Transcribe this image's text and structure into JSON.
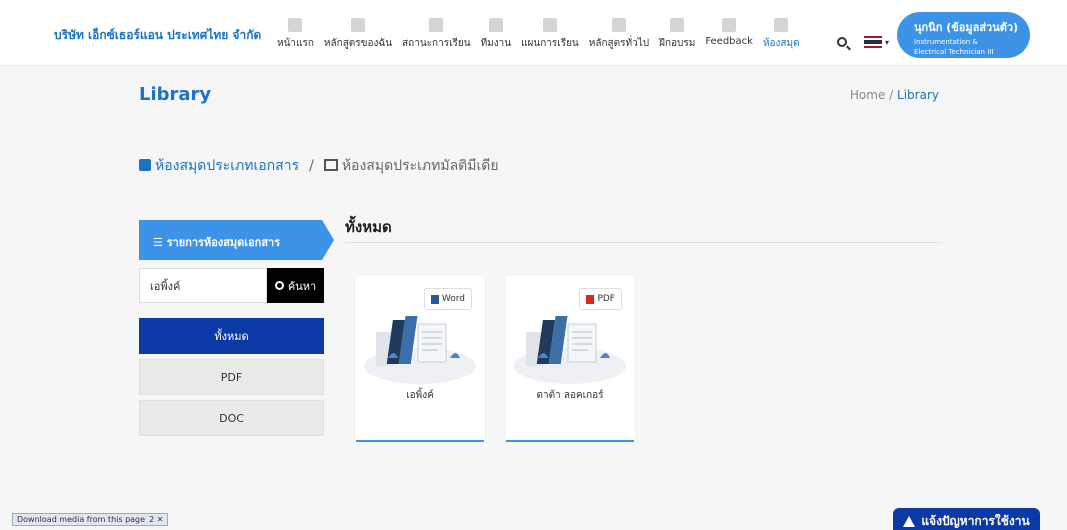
{
  "brand": "บริษัท เอ็กซ์เธอร์แอน ประเทศไทย จำกัด",
  "nav": [
    {
      "label": "หน้าแรก",
      "icon": "home-icon",
      "active": false
    },
    {
      "label": "หลักสูตรของฉัน",
      "icon": "list-icon",
      "active": false
    },
    {
      "label": "สถานะการเรียน",
      "icon": "chart-icon",
      "active": false
    },
    {
      "label": "ทีมงาน",
      "icon": "team-icon",
      "active": false
    },
    {
      "label": "แผนการเรียน",
      "icon": "book-icon",
      "active": false
    },
    {
      "label": "หลักสูตรทั่วไป",
      "icon": "graduation-cap-icon",
      "active": false
    },
    {
      "label": "ฝึกอบรม",
      "icon": "training-icon",
      "active": false
    },
    {
      "label": "Feedback",
      "icon": "chat-icon",
      "active": false
    },
    {
      "label": "ห้องสมุด",
      "icon": "library-icon",
      "active": true
    }
  ],
  "user": {
    "name": "นุกนิก (ข้อมูลส่วนตัว)",
    "role_line1": "Instrumentation &",
    "role_line2": "Electrical Technician III"
  },
  "page": {
    "title": "Library",
    "crumb_home": "Home",
    "crumb_sep": "/",
    "crumb_current": "Library"
  },
  "lib_nav": {
    "documents": "ห้องสมุดประเภทเอกสาร",
    "sep": "/",
    "multimedia": "ห้องสมุดประเภทมัลติมีเดีย"
  },
  "sidebar": {
    "header": "☰ รายการห้องสมุดเอกสาร",
    "search_value": "เอพิ้งค์",
    "search_button": "ค้นหา",
    "filters": [
      "ทั้งหมด",
      "PDF",
      "DOC"
    ]
  },
  "content": {
    "section_title": "ทั้งหมด",
    "cards": [
      {
        "name": "เอพิ้งค์",
        "type": "Word"
      },
      {
        "name": "ดาต้า ลอคเกอร์",
        "type": "PDF"
      }
    ]
  },
  "footer": {
    "download": "Download media from this page",
    "download_extra": "2 ✕",
    "report": "แจ้งปัญหาการใช้งาน"
  },
  "colors": {
    "primary": "#1a73c4",
    "accent": "#3d93e8",
    "dark_blue": "#0b3aa6"
  }
}
